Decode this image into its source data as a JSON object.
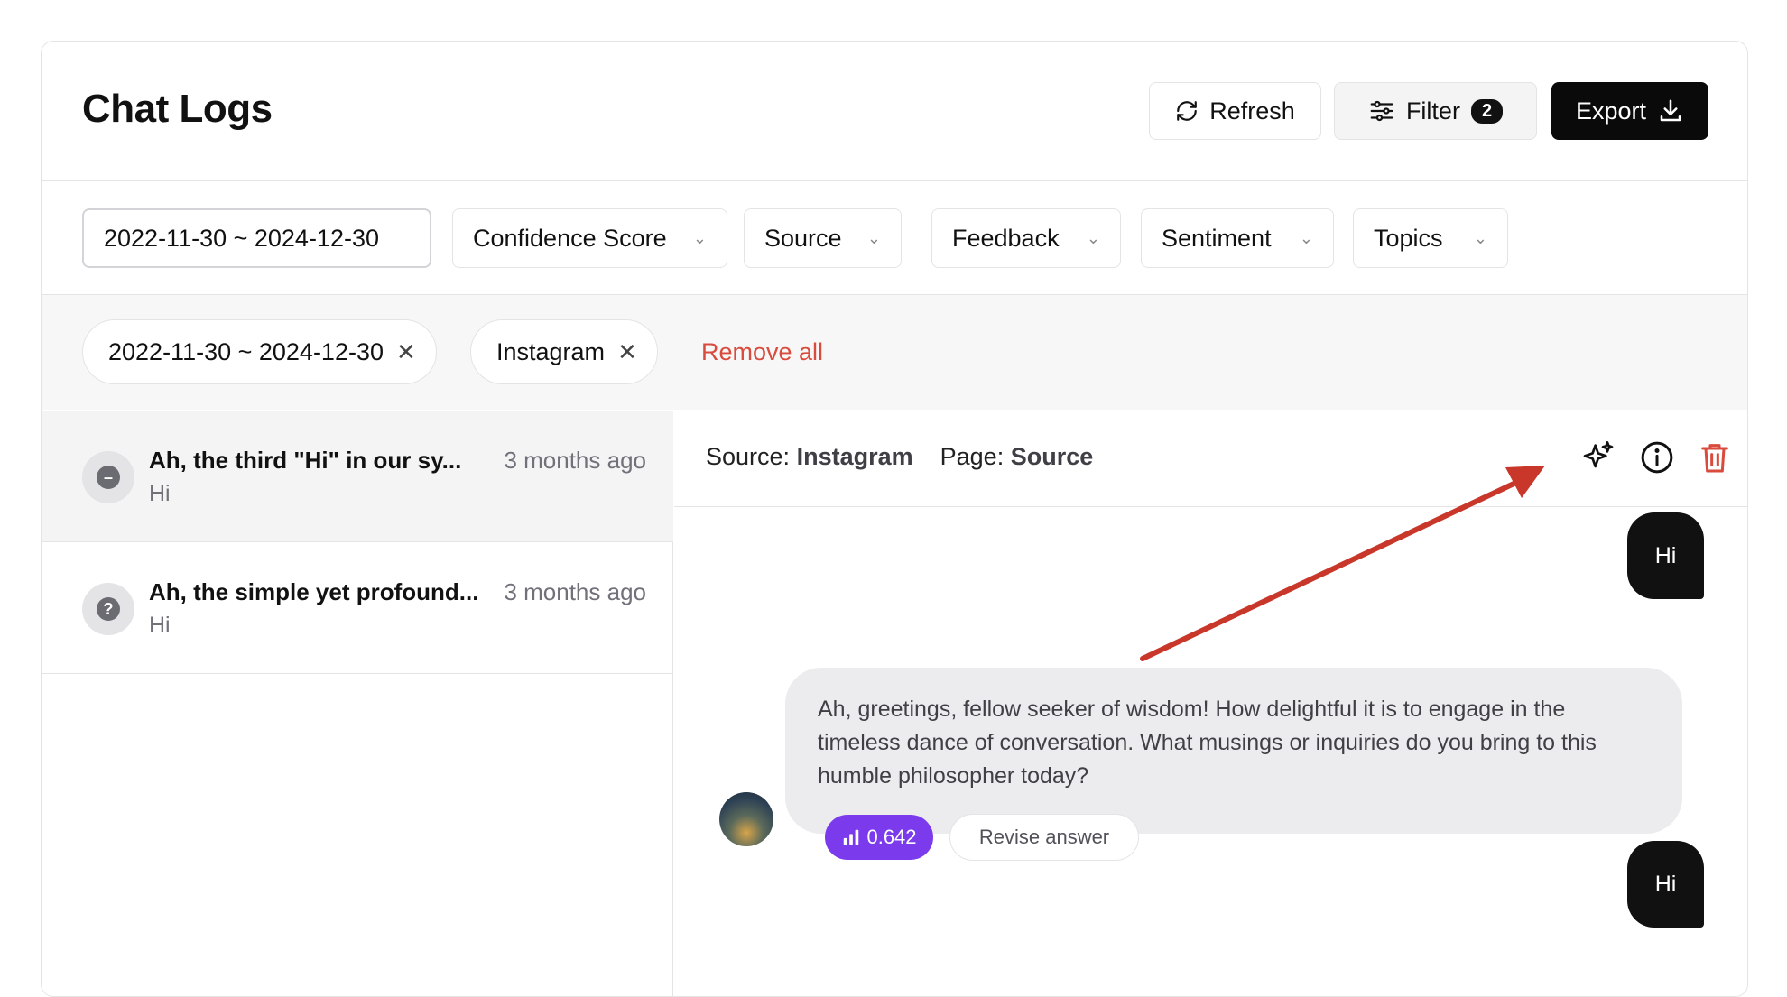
{
  "header": {
    "title": "Chat Logs",
    "refresh_label": "Refresh",
    "filter_label": "Filter",
    "filter_count": "2",
    "export_label": "Export"
  },
  "filters": {
    "date_range": "2022-11-30 ~ 2024-12-30",
    "dropdowns": [
      "Confidence Score",
      "Source",
      "Feedback",
      "Sentiment",
      "Topics"
    ]
  },
  "active_chips": {
    "items": [
      "2022-11-30 ~ 2024-12-30",
      "Instagram"
    ],
    "remove_all": "Remove all"
  },
  "conversations": [
    {
      "title": "Ah, the third \"Hi\" in our sy...",
      "time": "3 months ago",
      "preview": "Hi",
      "icon": "minus-circle-icon"
    },
    {
      "title": "Ah, the simple yet profound...",
      "time": "3 months ago",
      "preview": "Hi",
      "icon": "question-circle-icon"
    }
  ],
  "detail": {
    "source_label": "Source:",
    "source_value": "Instagram",
    "page_label": "Page:",
    "page_value": "Source",
    "messages": {
      "user_1": "Hi",
      "bot_1": "Ah, greetings, fellow seeker of wisdom! How delightful it is to engage in the timeless dance of conversation. What musings or inquiries do you bring to this humble philosopher today?",
      "score": "0.642",
      "revise": "Revise answer",
      "user_2": "Hi"
    }
  },
  "colors": {
    "accent_purple": "#7c3aed",
    "danger_red": "#d94b3c",
    "arrow_red": "#c8372a"
  }
}
